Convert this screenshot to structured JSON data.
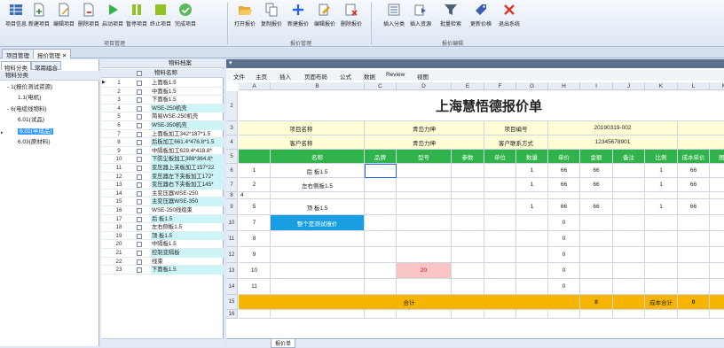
{
  "ribbon": {
    "groups": [
      {
        "label": "项目管理",
        "buttons": [
          {
            "label": "项目信息",
            "icon": "grid-icon"
          },
          {
            "label": "新建项目",
            "icon": "add-doc-icon"
          },
          {
            "label": "编辑项目",
            "icon": "edit-doc-icon"
          },
          {
            "label": "删除项目",
            "icon": "delete-doc-icon"
          },
          {
            "label": "启动项目",
            "icon": "play-icon"
          },
          {
            "label": "暂停项目",
            "icon": "pause-icon"
          },
          {
            "label": "终止项目",
            "icon": "stop-icon"
          },
          {
            "label": "完成项目",
            "icon": "check-icon"
          }
        ]
      },
      {
        "label": "报价管理",
        "buttons": [
          {
            "label": "打开报价",
            "icon": "folder-open-icon"
          },
          {
            "label": "复制报价",
            "icon": "copy-icon"
          },
          {
            "label": "新建报价",
            "icon": "plus-icon"
          },
          {
            "label": "编辑报价",
            "icon": "pencil-icon"
          },
          {
            "label": "删除报价",
            "icon": "delete-sheet-icon"
          }
        ]
      },
      {
        "label": "报价编辑",
        "buttons": [
          {
            "label": "插入分类",
            "icon": "insert-category-icon"
          },
          {
            "label": "插入资源",
            "icon": "insert-resource-icon"
          },
          {
            "label": "批量检索",
            "icon": "filter-icon"
          },
          {
            "label": "更新价格",
            "icon": "price-tag-icon"
          },
          {
            "label": "退出系统",
            "icon": "exit-x-icon"
          }
        ]
      }
    ]
  },
  "doc_tabs": [
    "项目管理",
    "报价管理"
  ],
  "left": {
    "tabs": [
      "物料分类",
      "常用组合"
    ],
    "header": "物料分类",
    "tree": [
      {
        "label": "1(报价测试资源)",
        "level": 1,
        "toggle": "-"
      },
      {
        "label": "1.1(电机)",
        "level": 2,
        "toggle": ""
      },
      {
        "label": "6(电缆线物料)",
        "level": 1,
        "toggle": "-"
      },
      {
        "label": "6.01(试品)",
        "level": 2,
        "toggle": ""
      },
      {
        "label": "6.02(半成品)",
        "level": 2,
        "toggle": "",
        "selected": true
      },
      {
        "label": "6.03(原材料)",
        "level": 2,
        "toggle": ""
      }
    ]
  },
  "middle": {
    "title": "物料档案",
    "header_col": "物料名称",
    "rows": [
      {
        "n": "1",
        "name": "上面板1.5",
        "cyan": false,
        "cur": true
      },
      {
        "n": "2",
        "name": "中面板1.5",
        "cyan": false
      },
      {
        "n": "3",
        "name": "下面板1.5",
        "cyan": false
      },
      {
        "n": "4",
        "name": "WSE-250机壳",
        "cyan": true
      },
      {
        "n": "5",
        "name": "简易WSE-250机壳",
        "cyan": false
      },
      {
        "n": "6",
        "name": "WSE-350机壳",
        "cyan": true
      },
      {
        "n": "7",
        "name": "上面板加工342*187*1.5",
        "cyan": false
      },
      {
        "n": "8",
        "name": "后板加工661.4*476.8*1.5",
        "cyan": true
      },
      {
        "n": "9",
        "name": "中隔板加工629.4*418.8*",
        "cyan": false
      },
      {
        "n": "10",
        "name": "下防尘板加工388*364.8*",
        "cyan": true
      },
      {
        "n": "11",
        "name": "变压器上夹板加工157*22",
        "cyan": true
      },
      {
        "n": "12",
        "name": "变压器左下夹板加工172*",
        "cyan": true
      },
      {
        "n": "13",
        "name": "变压器右下夹板加工145*",
        "cyan": true
      },
      {
        "n": "14",
        "name": "主变压器WSE-250",
        "cyan": false
      },
      {
        "n": "15",
        "name": "主变压器WSE-350",
        "cyan": true
      },
      {
        "n": "16",
        "name": "WSE-250线缆束",
        "cyan": false
      },
      {
        "n": "17",
        "name": "后 板1.5",
        "cyan": true
      },
      {
        "n": "18",
        "name": "左右侧板1.5",
        "cyan": false
      },
      {
        "n": "19",
        "name": "顶 板1.5",
        "cyan": true
      },
      {
        "n": "20",
        "name": "中隔板1.5",
        "cyan": false
      },
      {
        "n": "21",
        "name": "控制变隔板",
        "cyan": true
      },
      {
        "n": "22",
        "name": "线束",
        "cyan": false
      },
      {
        "n": "23",
        "name": "下面板1.5",
        "cyan": true
      }
    ]
  },
  "sheet": {
    "menu": [
      "文件",
      "主页",
      "插入",
      "页面布局",
      "公式",
      "数据",
      "Review",
      "视图"
    ],
    "columns": [
      "A",
      "B",
      "C",
      "D",
      "E",
      "F",
      "G",
      "H",
      "I",
      "J",
      "K",
      "L",
      "M"
    ],
    "title": "上海慧悟德报价单",
    "info": {
      "project_name_label": "项目名称",
      "project_name": "青岛力坤",
      "project_no_label": "项目编号",
      "project_no": "20190319-002",
      "customer_label": "客户名称",
      "customer": "青岛力坤",
      "contact_label": "客户联系方式",
      "contact": "12345678901"
    },
    "header": [
      "",
      "名称",
      "品牌",
      "型号",
      "参数",
      "单位",
      "数量",
      "单价",
      "金额",
      "备注",
      "比例",
      "成本单价",
      "图片"
    ],
    "row_nums": [
      "2",
      "3",
      "4",
      "5",
      "6",
      "7",
      "8",
      "9",
      "10",
      "11",
      "12",
      "13",
      "14",
      "15",
      "16"
    ],
    "rows": [
      {
        "a": "1",
        "b": "后 板1.5",
        "g": "1",
        "h": "66",
        "i": "66",
        "k": "1",
        "l": "66"
      },
      {
        "a": "2",
        "b": "左右侧板1.5",
        "g": "1",
        "h": "66",
        "i": "66",
        "k": "1",
        "l": "66"
      },
      {
        "a": "4",
        "b": "",
        "g": "",
        "h": "",
        "i": "",
        "k": "",
        "l": ""
      },
      {
        "a": "5",
        "b": "顶 板1.5",
        "g": "1",
        "h": "66",
        "i": "66",
        "k": "1",
        "l": "66"
      },
      {
        "a": "7",
        "b": "整个是测试报价",
        "g": "",
        "h": "0",
        "i": "",
        "k": "",
        "l": ""
      },
      {
        "a": "8",
        "b": "",
        "g": "",
        "h": "0",
        "i": "",
        "k": "",
        "l": ""
      },
      {
        "a": "9",
        "b": "",
        "g": "",
        "h": "0",
        "i": "",
        "k": "",
        "l": ""
      },
      {
        "a": "10",
        "b": "",
        "d": "20",
        "g": "",
        "h": "0",
        "i": "",
        "k": "",
        "l": ""
      },
      {
        "a": "11",
        "b": "",
        "g": "",
        "h": "0",
        "i": "",
        "k": "",
        "l": ""
      }
    ],
    "total_label": "合计",
    "total": "0",
    "cost_total_label": "成本合计",
    "cost_total": "0",
    "sheet_tabs": [
      "报价单"
    ]
  }
}
